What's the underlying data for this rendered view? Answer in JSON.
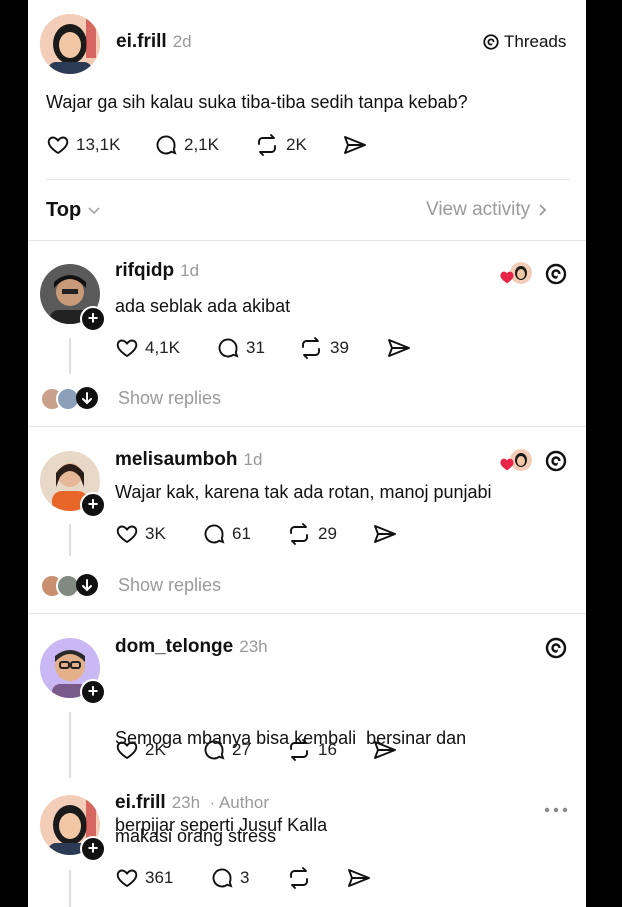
{
  "post": {
    "username": "ei.frill",
    "time": "2d",
    "brand": "Threads",
    "text": "Wajar ga sih kalau suka tiba-tiba sedih tanpa kebab?",
    "likes": "13,1K",
    "comments": "2,1K",
    "reposts": "2K"
  },
  "sort": {
    "label": "Top",
    "view_activity": "View activity"
  },
  "replies": [
    {
      "username": "rifqidp",
      "time": "1d",
      "text_lines": [
        "ada seblak ada akibat"
      ],
      "likes": "4,1K",
      "comments": "31",
      "reposts": "39",
      "show_replies": "Show replies"
    },
    {
      "username": "melisaumboh",
      "time": "1d",
      "text_lines": [
        "Wajar kak, karena tak ada rotan, manoj punjabi"
      ],
      "likes": "3K",
      "comments": "61",
      "reposts": "29",
      "show_replies": "Show replies"
    },
    {
      "username": "dom_telonge",
      "time": "23h",
      "text_lines": [
        "Semoga mbanya bisa kembali  bersinar dan",
        "berpijar seperti Jusuf Kalla"
      ],
      "likes": "2K",
      "comments": "27",
      "reposts": "16"
    },
    {
      "username": "ei.frill",
      "time": "23h",
      "author_tag": "· Author",
      "text_lines": [
        "makasi orang stress"
      ],
      "likes": "361",
      "comments": "3",
      "reposts": ""
    }
  ],
  "colors": {
    "heart_red": "#e8264a",
    "muted": "#9a9a9a",
    "divider": "#e6e6e6"
  }
}
